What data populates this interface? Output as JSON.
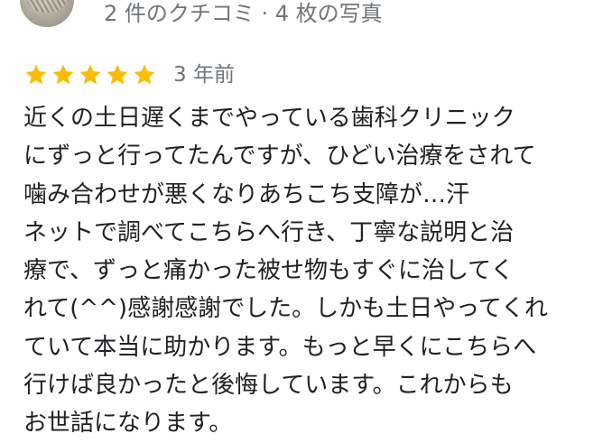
{
  "reviewer": {
    "meta": "2 件のクチコミ · 4 枚の写真"
  },
  "rating": {
    "stars": 5,
    "max_stars": 5,
    "star_color": "#fbbc04",
    "date": "3 年前"
  },
  "review": {
    "lines": [
      "近くの土日遅くまでやっている歯科クリニック",
      "にずっと行ってたんですが、ひどい治療をされて",
      "噛み合わせが悪くなりあちこち支障が…汗",
      "ネットで調べてこちらへ行き、丁寧な説明と治",
      "療で、ずっと痛かった被せ物もすぐに治してく",
      "れて(^^)感謝感謝でした。しかも土日やってくれ",
      "ていて本当に助かります。もっと早くにこちらへ",
      "行けば良かったと後悔しています。これからも",
      "お世話になります。"
    ]
  },
  "icons": {
    "avatar": "reviewer-avatar",
    "menu": "more-vert-icon",
    "star": "star-icon"
  }
}
